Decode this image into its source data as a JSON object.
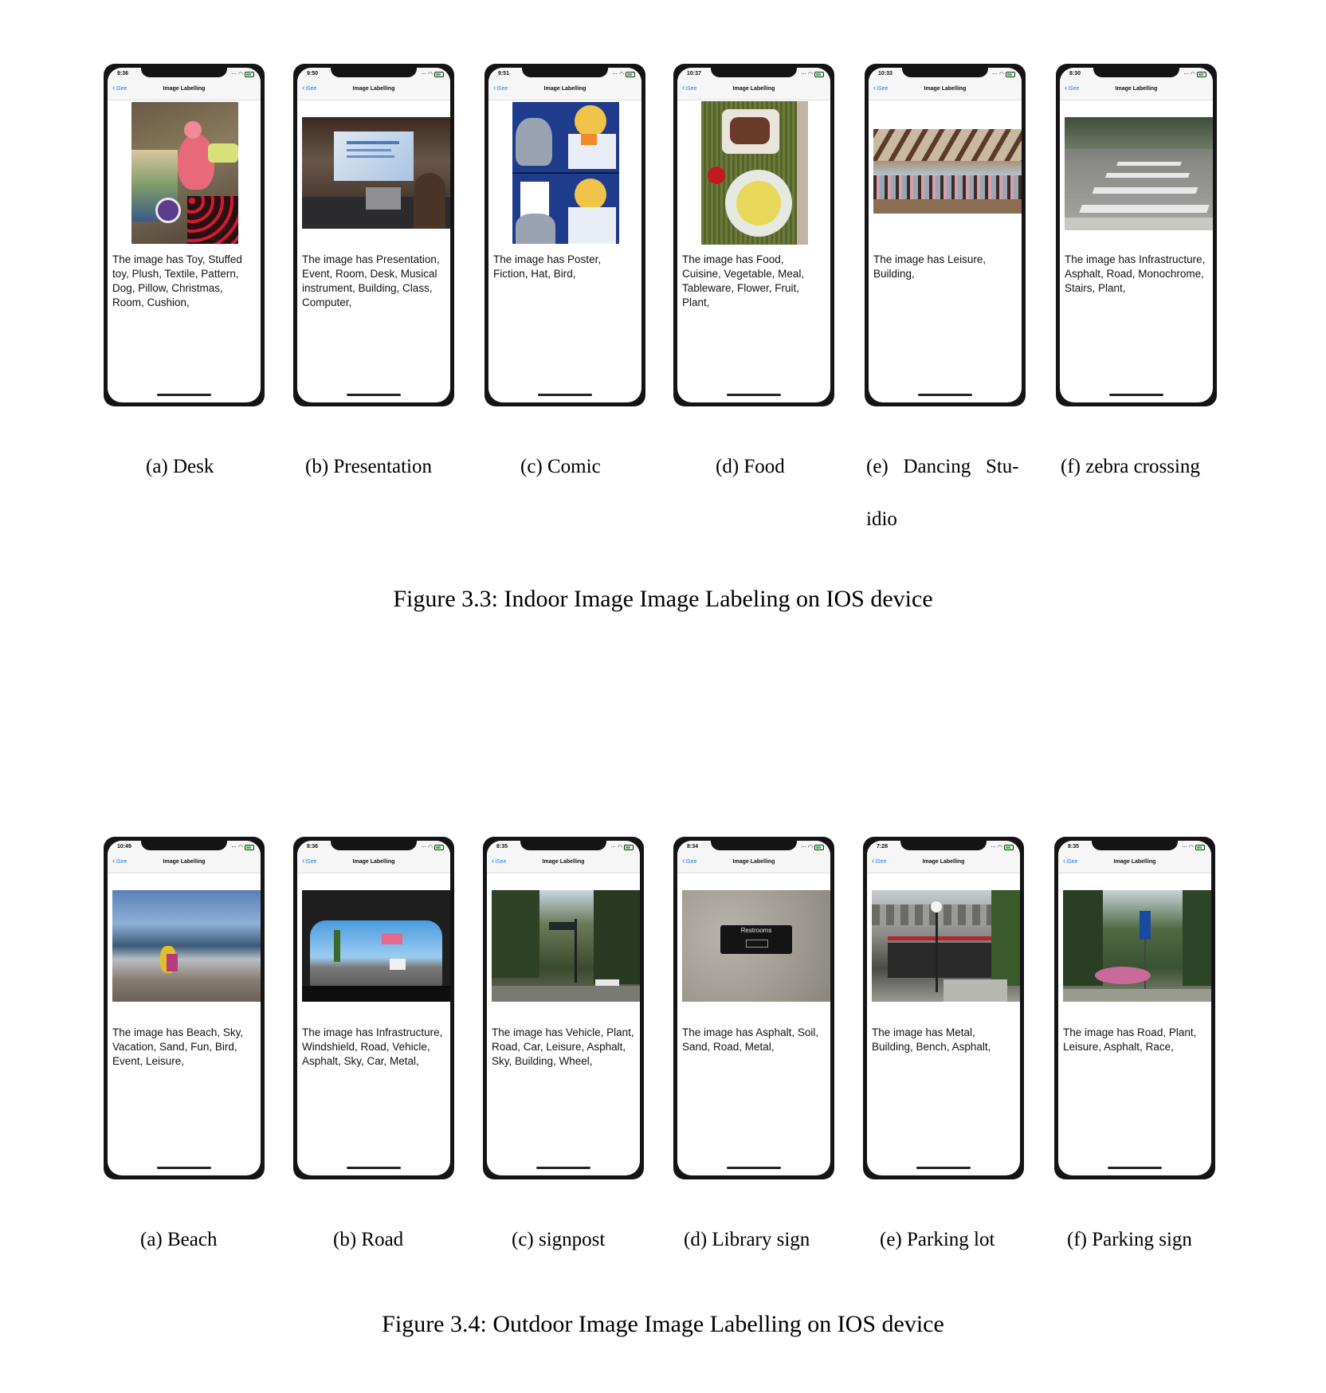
{
  "figure_1": {
    "caption": "Figure 3.3: Indoor Image Image Labeling on IOS device",
    "panels": [
      {
        "time": "9:36",
        "back": "iSee",
        "title": "Image Labelling",
        "labels": "The image has   Toy, Stuffed toy, Plush, Textile, Pattern, Dog, Pillow, Christmas, Room, Cushion,",
        "subcaption": "(a)  Desk"
      },
      {
        "time": "9:50",
        "back": "iSee",
        "title": "Image Labelling",
        "labels": "The image has Presentation, Event, Room, Desk, Musical instrument, Building, Class, Computer,",
        "subcaption": "(b)  Presentation"
      },
      {
        "time": "9:51",
        "back": "iSee",
        "title": "Image Labelling",
        "labels": "The image has   Poster, Fiction, Hat, Bird,",
        "subcaption": "(c)  Comic"
      },
      {
        "time": "10:37",
        "back": "iSee",
        "title": "Image Labelling",
        "labels": "The image has   Food, Cuisine, Vegetable, Meal, Tableware, Flower, Fruit, Plant,",
        "subcaption": "(d)  Food"
      },
      {
        "time": "10:33",
        "back": "iSee",
        "title": "Image Labelling",
        "labels": "The image has   Leisure, Building,",
        "subcaption_line1": "(e)   Dancing   Stu-",
        "subcaption_line2": "idio"
      },
      {
        "time": "8:30",
        "back": "iSee",
        "title": "Image Labelling",
        "labels": "The image has Infrastructure, Asphalt, Road, Monochrome, Stairs, Plant,",
        "subcaption": "(f)  zebra crossing"
      }
    ]
  },
  "figure_2": {
    "caption": "Figure 3.4: Outdoor Image Image Labelling on IOS device",
    "panels": [
      {
        "time": "10:49",
        "back": "iSee",
        "title": "Image Labelling",
        "labels": "The image has   Beach, Sky, Vacation, Sand, Fun, Bird, Event, Leisure,",
        "subcaption": "(a)  Beach"
      },
      {
        "time": "8:36",
        "back": "iSee",
        "title": "Image Labelling",
        "labels": "The image has Infrastructure, Windshield, Road, Vehicle, Asphalt, Sky, Car, Metal,",
        "subcaption": "(b)  Road"
      },
      {
        "time": "8:35",
        "back": "iSee",
        "title": "Image Labelling",
        "labels": "The image has   Vehicle, Plant, Road, Car, Leisure, Asphalt, Sky, Building, Wheel,",
        "subcaption": "(c)  signpost"
      },
      {
        "time": "8:34",
        "back": "iSee",
        "title": "Image Labelling",
        "labels": "The image has   Asphalt, Soil, Sand, Road, Metal,",
        "subcaption": "(d)  Library sign",
        "sign_text": "Restrooms"
      },
      {
        "time": "7:28",
        "back": "iSee",
        "title": "Image Labelling",
        "labels": "The image has   Metal, Building, Bench, Asphalt,",
        "subcaption": "(e)  Parking lot"
      },
      {
        "time": "8:35",
        "back": "iSee",
        "title": "Image Labelling",
        "labels": "The image has   Road, Plant, Leisure, Asphalt, Race,",
        "subcaption": "(f)  Parking sign"
      }
    ]
  },
  "icons": {
    "back": "chevron-left-icon",
    "wifi": "wifi-icon",
    "battery": "battery-icon",
    "signal": "signal-icon"
  }
}
